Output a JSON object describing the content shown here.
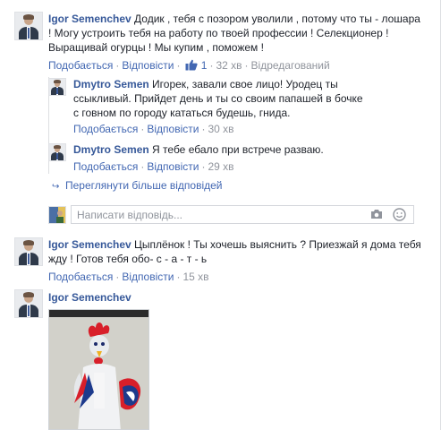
{
  "comments": [
    {
      "author": "Igor Semenchev",
      "text": "Додик , тебя с позором уволили , потому что ты - лошара ! Могу устроить тебя на работу по твоей профессии ! Селекционер ! Выращивай огурцы ! Мы купим , поможем !",
      "like_label": "Подобається",
      "reply_label": "Відповісти",
      "like_count": "1",
      "time": "32 хв",
      "edited_label": "Відредагований"
    },
    {
      "author": "Igor Semenchev",
      "text": "Цыплёнок ! Ты хочешь выяснить ? Приезжай я дома тебя жду ! Готов тебя обо- с - а - т - ь",
      "like_label": "Подобається",
      "reply_label": "Відповісти",
      "time": "15 хв"
    },
    {
      "author": "Igor Semenchev"
    }
  ],
  "replies": [
    {
      "author": "Dmytro Semen",
      "text": "Игорек, завали свое лицо! Уродец ты ссыкливый. Прийдет день и ты со своим папашей в бочке с говном по городу кататься будешь, гнида.",
      "like_label": "Подобається",
      "reply_label": "Відповісти",
      "time": "30 хв"
    },
    {
      "author": "Dmytro Semen",
      "text": "Я тебе ебало при встрече разваю.",
      "like_label": "Подобається",
      "reply_label": "Відповісти",
      "time": "29 хв"
    }
  ],
  "more_replies_label": "Переглянути більше відповідей",
  "reply_box": {
    "placeholder": "Написати відповідь..."
  },
  "icons": {
    "like": "thumbs-up-icon",
    "camera": "camera-icon",
    "emoji": "smiley-icon",
    "arrow": "reply-arrow-icon"
  },
  "colors": {
    "link": "#4267b2",
    "author": "#365899",
    "meta": "#90949c"
  }
}
